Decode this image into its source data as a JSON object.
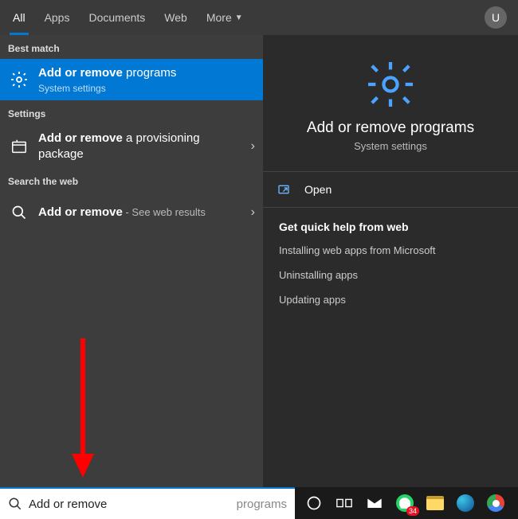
{
  "header": {
    "tabs": {
      "all": "All",
      "apps": "Apps",
      "documents": "Documents",
      "web": "Web",
      "more": "More"
    },
    "avatar": "U"
  },
  "left": {
    "sect_best": "Best match",
    "sect_settings": "Settings",
    "sect_web": "Search the web",
    "best": {
      "bold": "Add or remove",
      "rest": " programs",
      "sub": "System settings"
    },
    "provisioning": {
      "bold": "Add or remove",
      "rest": " a provisioning package"
    },
    "websearch": {
      "bold": "Add or remove",
      "rest": " - See web results"
    }
  },
  "right": {
    "title": "Add or remove programs",
    "subtitle": "System settings",
    "open": "Open",
    "help_head": "Get quick help from web",
    "links": {
      "install": "Installing web apps from Microsoft",
      "uninstall": "Uninstalling apps",
      "update": "Updating apps"
    }
  },
  "search": {
    "value": "Add or remove ",
    "placeholder": "programs"
  },
  "tray": {
    "whatsapp_badge": "34"
  }
}
